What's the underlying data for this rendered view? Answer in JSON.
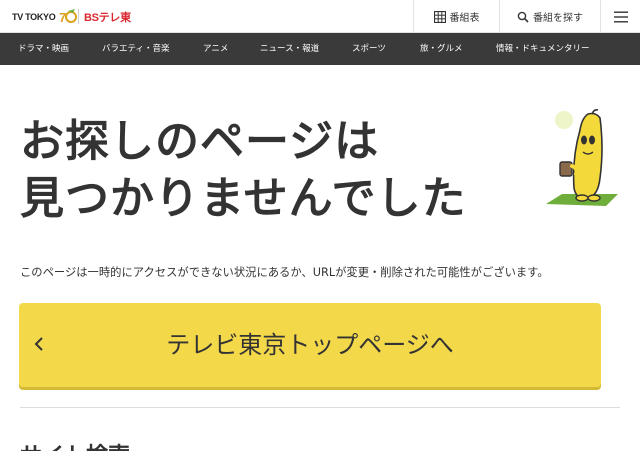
{
  "header": {
    "logo_tvtokyo": "TV TOKYO",
    "logo_bs": "BSテレ東",
    "schedule_label": "番組表",
    "search_label": "番組を探す",
    "icons": {
      "schedule": "grid-icon",
      "search": "search-icon",
      "menu": "hamburger-menu-icon"
    }
  },
  "nav": {
    "items": [
      {
        "label": "ドラマ・映画"
      },
      {
        "label": "バラエティ・音楽"
      },
      {
        "label": "アニメ"
      },
      {
        "label": "ニュース・報道"
      },
      {
        "label": "スポーツ"
      },
      {
        "label": "旅・グルメ"
      },
      {
        "label": "情報・ドキュメンタリー"
      }
    ]
  },
  "main": {
    "title_line1": "お探しのページは",
    "title_line2": "見つかりませんでした",
    "message": "このページは一時的にアクセスができない状況にあるか、URLが変更・削除された可能性がございます。",
    "top_button_label": "テレビ東京トップページへ",
    "sitemap_title": "サイト検索"
  },
  "colors": {
    "nav_bg": "#3a3a3a",
    "button_yellow": "#f3d84a",
    "brand_red": "#d9272e",
    "text": "#333333"
  }
}
